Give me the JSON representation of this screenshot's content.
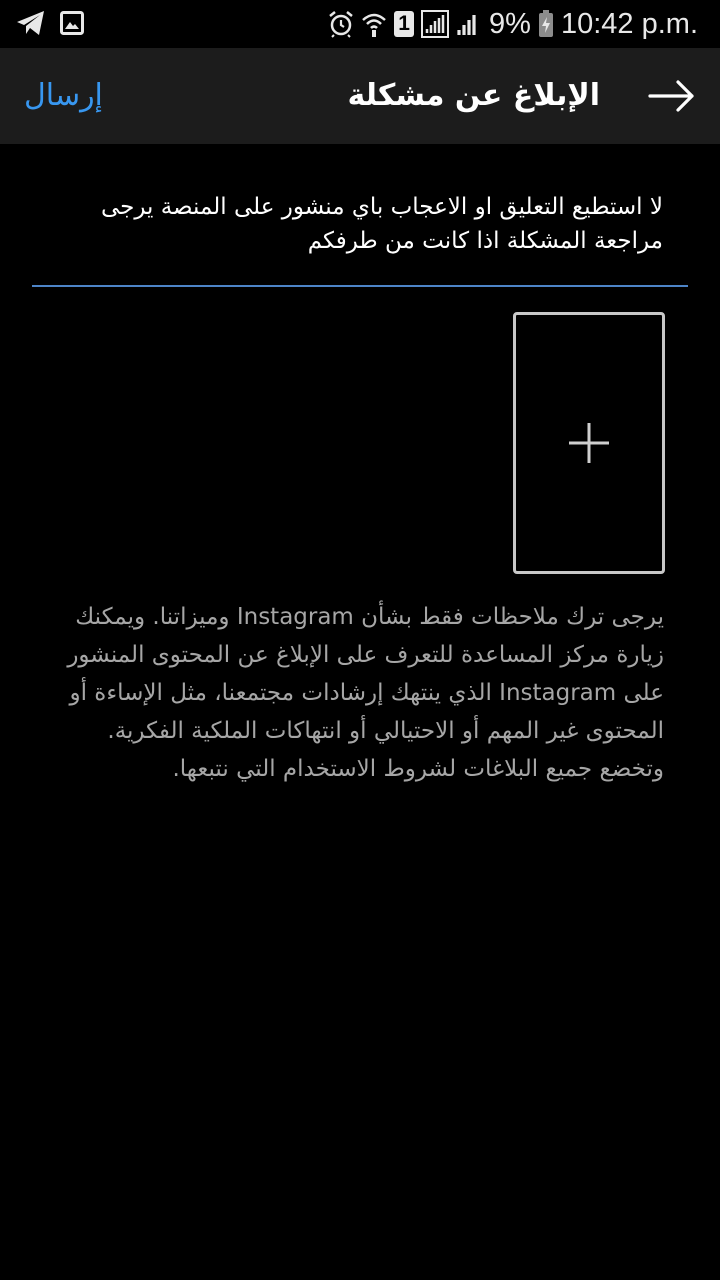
{
  "status_bar": {
    "battery": "9%",
    "time": "10:42 p.m.",
    "sim_badge": "1",
    "icons": [
      "telegram-icon",
      "gallery-icon",
      "alarm-icon",
      "wifi-icon",
      "sim-icon",
      "signal-icon",
      "battery-icon"
    ]
  },
  "app_bar": {
    "submit_label": "إرسال",
    "title": "الإبلاغ عن مشكلة",
    "back_icon": "arrow-right-icon"
  },
  "report": {
    "text": "لا استطيع التعليق او الاعجاب باي منشور على المنصة يرجى مراجعة المشكلة اذا كانت من طرفكم"
  },
  "add_photo": {
    "icon": "plus-icon"
  },
  "info": {
    "text": "يرجى ترك ملاحظات فقط بشأن Instagram وميزاتنا. ويمكنك زيارة مركز المساعدة للتعرف على الإبلاغ عن المحتوى المنشور على Instagram الذي ينتهك إرشادات مجتمعنا، مثل الإساءة أو المحتوى غير المهم أو الاحتيالي أو انتهاكات الملكية الفكرية. وتخضع جميع البلاغات لشروط الاستخدام التي نتبعها."
  },
  "colors": {
    "background": "#000000",
    "app_bar": "#1c1c1c",
    "accent": "#3897f0",
    "divider": "#4d84c7",
    "secondary_text": "#a6a6a6"
  }
}
